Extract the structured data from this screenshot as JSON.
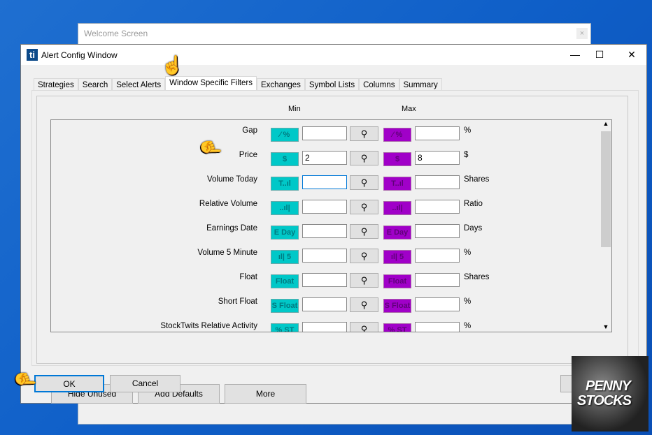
{
  "welcome": {
    "title": "Welcome Screen",
    "close": "×"
  },
  "window": {
    "title": "Alert Config Window",
    "logo": "ti",
    "controls": {
      "minimize": "—",
      "maximize": "☐",
      "close": "✕"
    }
  },
  "tabs": [
    {
      "label": "Strategies"
    },
    {
      "label": "Search"
    },
    {
      "label": "Select Alerts"
    },
    {
      "label": "Window Specific Filters",
      "active": true
    },
    {
      "label": "Exchanges"
    },
    {
      "label": "Symbol Lists"
    },
    {
      "label": "Columns"
    },
    {
      "label": "Summary"
    }
  ],
  "headers": {
    "min": "Min",
    "max": "Max"
  },
  "filters": [
    {
      "label": "Gap",
      "icon": "⁄ %",
      "min": "",
      "max": "",
      "unit": "%"
    },
    {
      "label": "Price",
      "icon": "$",
      "min": "2",
      "max": "8",
      "unit": "$"
    },
    {
      "label": "Volume Today",
      "icon": "T..ıl",
      "min": "",
      "max": "",
      "unit": "Shares"
    },
    {
      "label": "Relative Volume",
      "icon": "..ıl|",
      "min": "",
      "max": "",
      "unit": "Ratio"
    },
    {
      "label": "Earnings Date",
      "icon": "E Day",
      "min": "",
      "max": "",
      "unit": "Days"
    },
    {
      "label": "Volume 5 Minute",
      "icon": "ıl| 5",
      "min": "",
      "max": "",
      "unit": "%"
    },
    {
      "label": "Float",
      "icon": "Float",
      "min": "",
      "max": "",
      "unit": "Shares"
    },
    {
      "label": "Short Float",
      "icon": "S Float",
      "min": "",
      "max": "",
      "unit": "%"
    },
    {
      "label": "StockTwits Relative Activity",
      "icon": "% ST",
      "min": "",
      "max": "",
      "unit": "%"
    }
  ],
  "search_icon": "⚲",
  "buttons": {
    "hide_unused": "Hide Unused",
    "add_defaults": "Add Defaults",
    "more": "More",
    "ok": "OK",
    "cancel": "Cancel"
  },
  "overlay": {
    "logo_line1": "PENNY",
    "logo_line2": "STOCKS"
  },
  "colors": {
    "min_icon": "#00c8c8",
    "max_icon": "#a000c8",
    "desktop": "#1565c8"
  }
}
